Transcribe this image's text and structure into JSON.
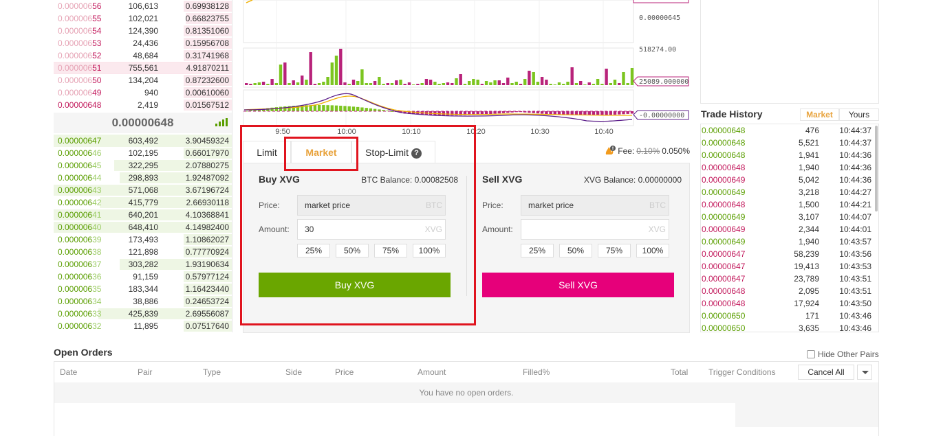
{
  "orderbook": {
    "asks": [
      {
        "dim": "0.000006",
        "bold": "56",
        "amount": "106,613",
        "total": "0.69938128",
        "depth": 0.27
      },
      {
        "dim": "0.000006",
        "bold": "55",
        "amount": "102,021",
        "total": "0.66823755",
        "depth": 0.26
      },
      {
        "dim": "0.000006",
        "bold": "54",
        "amount": "124,390",
        "total": "0.81351060",
        "depth": 0.27
      },
      {
        "dim": "0.000006",
        "bold": "53",
        "amount": "24,436",
        "total": "0.15956708",
        "depth": 0.27
      },
      {
        "dim": "0.000006",
        "bold": "52",
        "amount": "48,684",
        "total": "0.31741968",
        "depth": 0.27
      },
      {
        "dim": "0.000006",
        "bold": "51",
        "amount": "755,561",
        "total": "4.91870211",
        "depth": 1.0,
        "highlight": true
      },
      {
        "dim": "0.000006",
        "bold": "50",
        "amount": "134,204",
        "total": "0.87232600",
        "depth": 0.27
      },
      {
        "dim": "0.000006",
        "bold": "49",
        "amount": "940",
        "total": "0.00610060",
        "depth": 0.27
      },
      {
        "dim": "",
        "bold": "0.00000648",
        "amount": "2,419",
        "total": "0.01567512",
        "depth": 0.27
      }
    ],
    "last_price": "0.00000648",
    "bids": [
      {
        "bold": "0.00000647",
        "dim": "",
        "amount": "603,492",
        "total": "3.90459324",
        "depth": 1.0,
        "highlight": true
      },
      {
        "bold": "0.000006",
        "dim": "46",
        "amount": "102,195",
        "total": "0.66017970",
        "depth": 0.27
      },
      {
        "bold": "0.000006",
        "dim": "45",
        "amount": "322,295",
        "total": "2.07880275",
        "depth": 0.66
      },
      {
        "bold": "0.000006",
        "dim": "44",
        "amount": "298,893",
        "total": "1.92487092",
        "depth": 0.63
      },
      {
        "bold": "0.000006",
        "dim": "43",
        "amount": "571,068",
        "total": "3.67196724",
        "depth": 1.0
      },
      {
        "bold": "0.000006",
        "dim": "42",
        "amount": "415,779",
        "total": "2.66930118",
        "depth": 0.74
      },
      {
        "bold": "0.000006",
        "dim": "41",
        "amount": "640,201",
        "total": "4.10368841",
        "depth": 1.0
      },
      {
        "bold": "0.000006",
        "dim": "40",
        "amount": "648,410",
        "total": "4.14982400",
        "depth": 1.0
      },
      {
        "bold": "0.000006",
        "dim": "39",
        "amount": "173,493",
        "total": "1.10862027",
        "depth": 0.27
      },
      {
        "bold": "0.000006",
        "dim": "38",
        "amount": "121,898",
        "total": "0.77770924",
        "depth": 0.27
      },
      {
        "bold": "0.000006",
        "dim": "37",
        "amount": "303,282",
        "total": "1.93190634",
        "depth": 0.63
      },
      {
        "bold": "0.000006",
        "dim": "36",
        "amount": "91,159",
        "total": "0.57977124",
        "depth": 0.27
      },
      {
        "bold": "0.000006",
        "dim": "35",
        "amount": "183,344",
        "total": "1.16423440",
        "depth": 0.27
      },
      {
        "bold": "0.000006",
        "dim": "34",
        "amount": "38,886",
        "total": "0.24653724",
        "depth": 0.27
      },
      {
        "bold": "0.000006",
        "dim": "33",
        "amount": "425,839",
        "total": "2.69556087",
        "depth": 0.75
      },
      {
        "bold": "0.000006",
        "dim": "32",
        "amount": "11,895",
        "total": "0.07517640",
        "depth": 0.27
      }
    ]
  },
  "chart": {
    "price_labels": [
      "0.00000645"
    ],
    "volume_labels": [
      "518274.00",
      "25089.000000"
    ],
    "indicator_labels": [
      "-0.00000000"
    ],
    "time_labels": [
      "9:50",
      "10:00",
      "10:10",
      "10:20",
      "10:30",
      "10:40"
    ],
    "colors": {
      "up": "#7cc520",
      "down": "#b8237a",
      "ema_short": "#f0b000",
      "ema_long": "#5c1f8a"
    }
  },
  "trade": {
    "tabs": {
      "limit": "Limit",
      "market": "Market",
      "stop_limit": "Stop-Limit"
    },
    "fee": {
      "label": "Fee:",
      "old": "0.10%",
      "new": "0.050%"
    },
    "buy": {
      "title": "Buy XVG",
      "balance": "BTC Balance: 0.00082508",
      "price_label": "Price:",
      "price_value": "market price",
      "price_unit": "BTC",
      "amount_label": "Amount:",
      "amount_value": "30",
      "amount_unit": "XVG",
      "pcts": [
        "25%",
        "50%",
        "75%",
        "100%"
      ],
      "button": "Buy XVG",
      "color": "#6aa600"
    },
    "sell": {
      "title": "Sell XVG",
      "balance": "XVG Balance: 0.00000000",
      "price_label": "Price:",
      "price_value": "market price",
      "price_unit": "BTC",
      "amount_label": "Amount:",
      "amount_value": "",
      "amount_unit": "XVG",
      "pcts": [
        "25%",
        "50%",
        "75%",
        "100%"
      ],
      "button": "Sell XVG",
      "color": "#e6007a"
    }
  },
  "trade_history": {
    "title": "Trade History",
    "tabs": {
      "market": "Market",
      "yours": "Yours"
    },
    "rows": [
      {
        "price": "0.00000648",
        "amount": "476",
        "time": "10:44:37",
        "side": "up"
      },
      {
        "price": "0.00000648",
        "amount": "5,521",
        "time": "10:44:37",
        "side": "up"
      },
      {
        "price": "0.00000648",
        "amount": "1,941",
        "time": "10:44:36",
        "side": "up"
      },
      {
        "price": "0.00000648",
        "amount": "1,940",
        "time": "10:44:36",
        "side": "down"
      },
      {
        "price": "0.00000649",
        "amount": "5,042",
        "time": "10:44:36",
        "side": "down"
      },
      {
        "price": "0.00000649",
        "amount": "3,218",
        "time": "10:44:27",
        "side": "up"
      },
      {
        "price": "0.00000648",
        "amount": "1,500",
        "time": "10:44:21",
        "side": "down"
      },
      {
        "price": "0.00000649",
        "amount": "3,107",
        "time": "10:44:07",
        "side": "up"
      },
      {
        "price": "0.00000649",
        "amount": "2,344",
        "time": "10:44:01",
        "side": "down"
      },
      {
        "price": "0.00000649",
        "amount": "1,940",
        "time": "10:43:57",
        "side": "up"
      },
      {
        "price": "0.00000647",
        "amount": "58,239",
        "time": "10:43:56",
        "side": "down"
      },
      {
        "price": "0.00000647",
        "amount": "19,413",
        "time": "10:43:53",
        "side": "down"
      },
      {
        "price": "0.00000647",
        "amount": "23,789",
        "time": "10:43:51",
        "side": "down"
      },
      {
        "price": "0.00000648",
        "amount": "2,095",
        "time": "10:43:51",
        "side": "down"
      },
      {
        "price": "0.00000648",
        "amount": "17,924",
        "time": "10:43:50",
        "side": "down"
      },
      {
        "price": "0.00000650",
        "amount": "171",
        "time": "10:43:46",
        "side": "up"
      },
      {
        "price": "0.00000650",
        "amount": "3,635",
        "time": "10:43:46",
        "side": "up"
      }
    ]
  },
  "open_orders": {
    "title": "Open Orders",
    "hide_other_pairs": "Hide Other Pairs",
    "columns": [
      "Date",
      "Pair",
      "Type",
      "Side",
      "Price",
      "Amount",
      "Filled%",
      "Total",
      "Trigger Conditions"
    ],
    "cancel_all": "Cancel All",
    "empty": "You have no open orders."
  }
}
